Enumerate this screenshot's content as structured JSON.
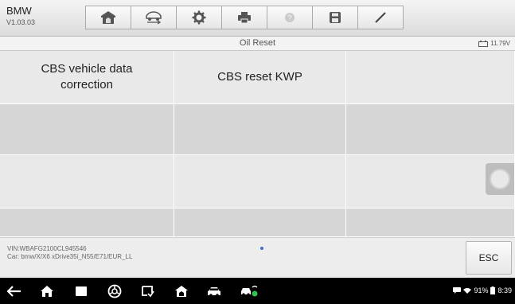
{
  "header": {
    "brand": "BMW",
    "version": "V1.03.03",
    "tools": [
      {
        "icon": "home-icon",
        "enabled": true
      },
      {
        "icon": "vehicle-swap-icon",
        "enabled": true
      },
      {
        "icon": "settings-gear-icon",
        "enabled": true
      },
      {
        "icon": "printer-icon",
        "enabled": true
      },
      {
        "icon": "help-icon",
        "enabled": false
      },
      {
        "icon": "save-icon",
        "enabled": true
      },
      {
        "icon": "pen-icon",
        "enabled": true
      }
    ]
  },
  "titlebar": {
    "title": "Oil Reset",
    "voltage": "11.79V"
  },
  "menu": {
    "rows": [
      [
        "CBS vehicle data correction",
        "CBS reset KWP",
        ""
      ],
      [
        "",
        "",
        ""
      ],
      [
        "",
        "",
        ""
      ],
      [
        "",
        "",
        ""
      ]
    ]
  },
  "footer": {
    "vin": "VIN:WBAFG2100CL945546",
    "car": "Car: bmw/X/X6 xDrive35i_N55/E71/EUR_LL",
    "esc_label": "ESC"
  },
  "navbar": {
    "icons": [
      "back-icon",
      "home-icon",
      "recent-apps-icon",
      "browser-icon",
      "screen-capture-icon",
      "maxisys-home-icon",
      "vehicle-icon",
      "vci-icon"
    ],
    "status_text": "91%",
    "clock": "8:39",
    "colors": {
      "navbar_bg": "#000000",
      "status_green": "#32c24d"
    }
  }
}
